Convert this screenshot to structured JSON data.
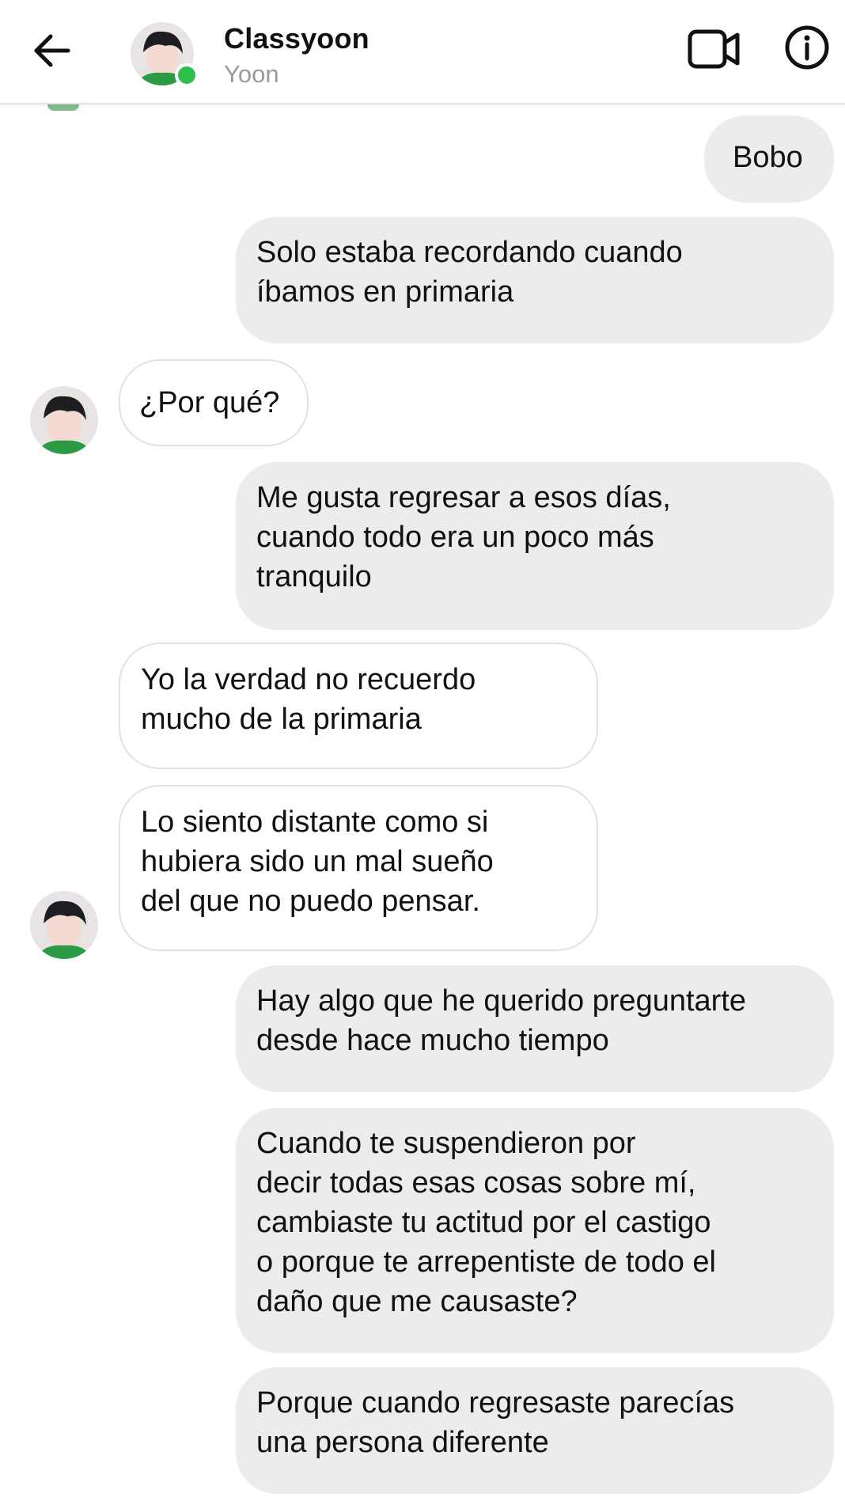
{
  "header": {
    "back_icon": "arrow-left-icon",
    "contact_name": "Classyoon",
    "contact_subtitle": "Yoon",
    "online_status_color": "#2fbf4f",
    "video_icon": "video-camera-icon",
    "info_icon": "info-circle-icon"
  },
  "messages": [
    {
      "direction": "outgoing",
      "lines": [
        "Bobo"
      ]
    },
    {
      "direction": "outgoing",
      "lines": [
        "Solo estaba recordando cuando",
        "íbamos en primaria"
      ]
    },
    {
      "direction": "incoming",
      "lines": [
        "¿Por qué?"
      ]
    },
    {
      "direction": "outgoing",
      "lines": [
        "Me gusta regresar a esos días,",
        "cuando todo era un poco más",
        "tranquilo"
      ]
    },
    {
      "direction": "incoming",
      "lines": [
        "Yo la verdad no recuerdo",
        "mucho de la primaria"
      ]
    },
    {
      "direction": "incoming",
      "lines": [
        "Lo siento distante como si",
        "hubiera sido un mal sueño",
        "del que no puedo pensar."
      ]
    },
    {
      "direction": "outgoing",
      "lines": [
        "Hay algo que he querido preguntarte",
        "desde hace mucho tiempo"
      ]
    },
    {
      "direction": "outgoing",
      "lines": [
        "Cuando te suspendieron por",
        "decir todas esas cosas sobre mí,",
        "cambiaste tu actitud por el castigo",
        "o porque te arrepentiste de todo el",
        "daño que me causaste?"
      ]
    },
    {
      "direction": "outgoing",
      "lines": [
        "Porque cuando regresaste parecías",
        "una persona diferente"
      ]
    }
  ],
  "colors": {
    "outgoing_bubble": "#ececec",
    "incoming_bubble": "#ffffff",
    "incoming_border": "#e2e2e2",
    "subtitle_gray": "#9a9a9a"
  }
}
